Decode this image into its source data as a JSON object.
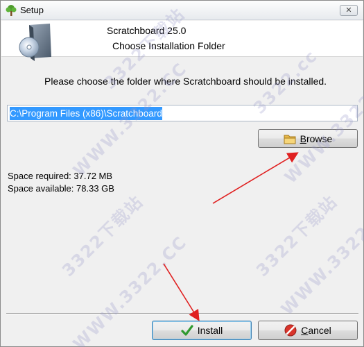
{
  "window": {
    "title": "Setup",
    "close_glyph": "✕"
  },
  "header": {
    "app_name": "Scratchboard 25.0",
    "subtitle": "Choose Installation Folder"
  },
  "prompt": "Please choose the folder where Scratchboard should be installed.",
  "path": {
    "value": "C:\\Program Files (x86)\\Scratchboard"
  },
  "browse": {
    "label_underlined": "B",
    "label_rest": "rowse",
    "icon": "folder-icon"
  },
  "space": {
    "required": "Space required: 37.72 MB",
    "available": "Space available: 78.33 GB"
  },
  "footer": {
    "install_label": "Install",
    "install_icon": "checkmark-icon",
    "cancel_underlined": "C",
    "cancel_rest": "ancel",
    "cancel_icon": "no-entry-icon"
  },
  "watermarks": [
    "3322.cc",
    "3322下载站",
    "WWW.3322.CC"
  ],
  "colors": {
    "selection": "#3399ff",
    "arrow": "#e02020",
    "install_border": "#3c7fb1"
  }
}
